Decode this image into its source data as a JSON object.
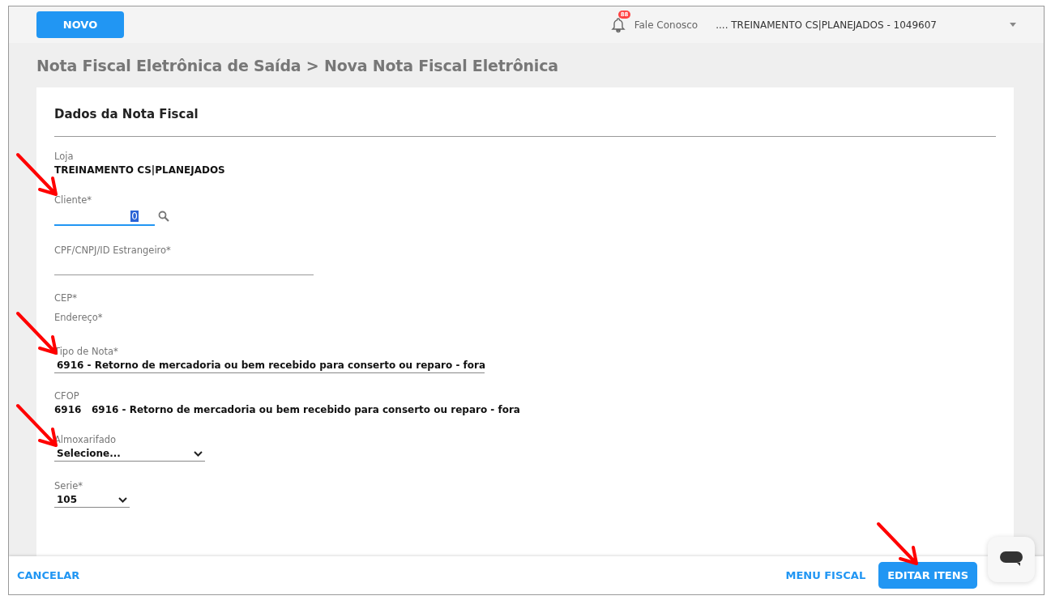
{
  "header": {
    "new_button": "NOVO",
    "notification_count": "88",
    "contact_link": "Fale Conosco",
    "store_selector": ".... TREINAMENTO CS|PLANEJADOS - 1049607"
  },
  "breadcrumb": "Nota Fiscal Eletrônica de Saída > Nova Nota Fiscal Eletrônica",
  "card": {
    "title": "Dados da Nota Fiscal",
    "fields": [
      {
        "kind": "readonly",
        "label": "Loja",
        "value": "TREINAMENTO CS|PLANEJADOS"
      },
      {
        "kind": "search",
        "label": "Cliente*",
        "value": "0",
        "focused": true
      },
      {
        "kind": "input",
        "label": "CPF/CNPJ/ID Estrangeiro*"
      },
      {
        "kind": "label",
        "label": "CEP*"
      },
      {
        "kind": "label",
        "label": "Endereço*"
      },
      {
        "kind": "select",
        "label": "Tipo de Nota*",
        "value": "6916 - Retorno de mercadoria ou bem recebido para conserto ou reparo - fora"
      },
      {
        "kind": "readonly",
        "label": "CFOP",
        "value": "6916   6916 - Retorno de mercadoria ou bem recebido para conserto ou reparo - fora"
      },
      {
        "kind": "select",
        "label": "Almoxarifado",
        "value": "Selecione..."
      },
      {
        "kind": "select",
        "label": "Serie*",
        "value": "105"
      }
    ]
  },
  "footer": {
    "cancel": "CANCELAR",
    "menu": "MENU FISCAL",
    "edit_items": "EDITAR ITENS"
  }
}
